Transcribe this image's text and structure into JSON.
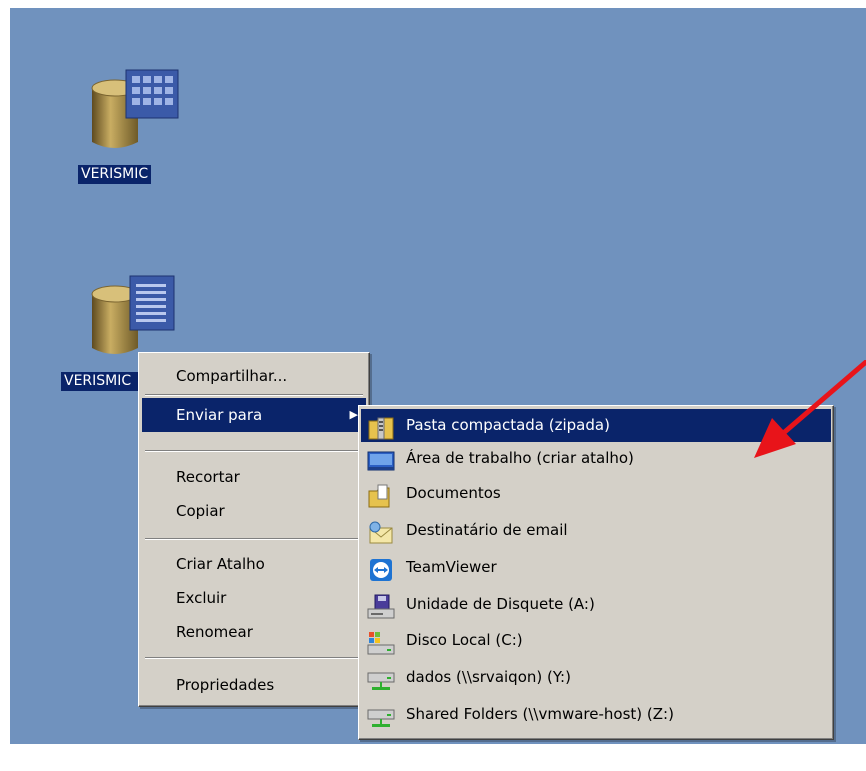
{
  "desktop": {
    "background": "#7092be",
    "icons": [
      {
        "label": "VERISMIC",
        "icon": "database-grid-icon"
      },
      {
        "label": "VERISMIC",
        "icon": "database-document-icon"
      }
    ]
  },
  "context_menu": {
    "items": {
      "compartilhar": "Compartilhar...",
      "enviar_para": "Enviar para",
      "recortar": "Recortar",
      "copiar": "Copiar",
      "criar_atalho": "Criar Atalho",
      "excluir": "Excluir",
      "renomear": "Renomear",
      "propriedades": "Propriedades"
    },
    "submenu_arrow": "▶"
  },
  "send_to_submenu": {
    "items": [
      {
        "label": "Pasta compactada (zipada)",
        "icon": "zip-folder-icon",
        "selected": true
      },
      {
        "label": "Área de trabalho (criar atalho)",
        "icon": "desktop-icon"
      },
      {
        "label": "Documentos",
        "icon": "documents-folder-icon"
      },
      {
        "label": "Destinatário de email",
        "icon": "mail-icon"
      },
      {
        "label": "TeamViewer",
        "icon": "teamviewer-icon"
      },
      {
        "label": "Unidade de Disquete (A:)",
        "icon": "floppy-drive-icon"
      },
      {
        "label": "Disco Local (C:)",
        "icon": "local-disk-icon"
      },
      {
        "label": "dados (\\\\srvaiqon) (Y:)",
        "icon": "network-drive-icon"
      },
      {
        "label": "Shared Folders (\\\\vmware-host) (Z:)",
        "icon": "network-drive-icon"
      }
    ]
  },
  "colors": {
    "selection": "#0a246a",
    "menu_bg": "#d4d0c8",
    "annotation_arrow": "#e8141a"
  }
}
